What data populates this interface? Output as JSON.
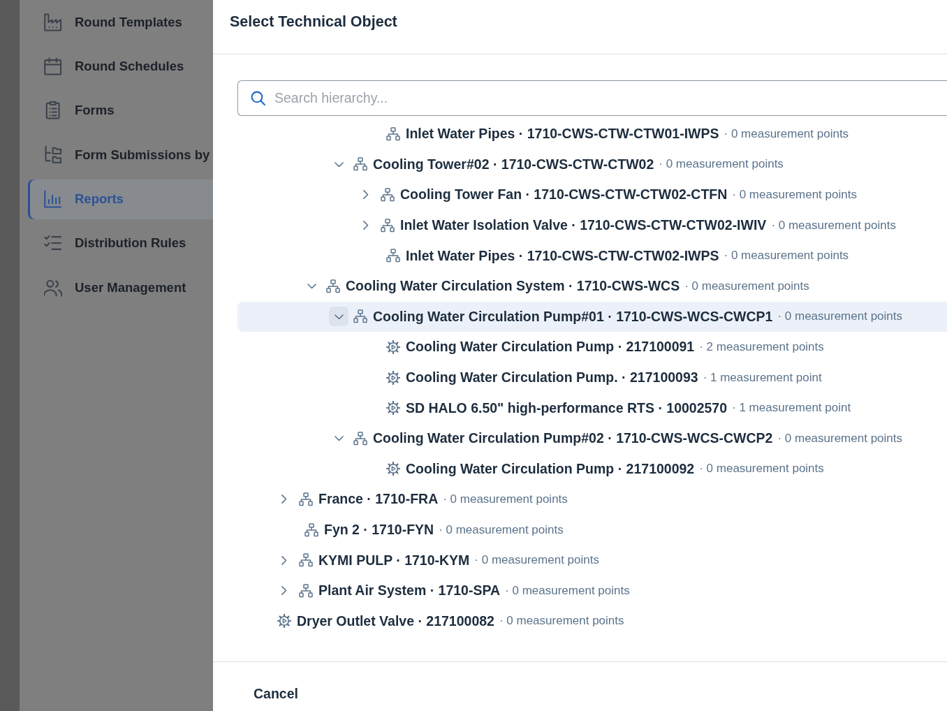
{
  "sidebar": {
    "items": [
      {
        "label": "Round Templates",
        "selected": false
      },
      {
        "label": "Round Schedules",
        "selected": false
      },
      {
        "label": "Forms",
        "selected": false
      },
      {
        "label": "Form Submissions by",
        "selected": false
      },
      {
        "label": "Reports",
        "selected": true
      },
      {
        "label": "Distribution Rules",
        "selected": false
      },
      {
        "label": "User Management",
        "selected": false
      }
    ]
  },
  "dialog": {
    "title": "Select Technical Object",
    "search": {
      "placeholder": "Search hierarchy..."
    },
    "tree": [
      {
        "children": [
          {
            "children": [
              {
                "children": [
                  {
                    "children": [
                      {
                        "kind": "location",
                        "title": "Inlet Water Pipes · 1710-CWS-CTW-CTW01-IWPS",
                        "meta": "· 0 measurement points",
                        "selected": false
                      }
                    ]
                  },
                  {
                    "kind": "location",
                    "title": "Cooling Tower#02 · 1710-CWS-CTW-CTW02",
                    "meta": "· 0 measurement points",
                    "selected": false,
                    "expanded": true,
                    "children": [
                      {
                        "kind": "location",
                        "title": "Cooling Tower Fan · 1710-CWS-CTW-CTW02-CTFN",
                        "meta": "· 0 measurement points",
                        "selected": false,
                        "expanded": false
                      },
                      {
                        "kind": "location",
                        "title": "Inlet Water Isolation Valve · 1710-CWS-CTW-CTW02-IWIV",
                        "meta": "· 0 measurement points",
                        "selected": false,
                        "expanded": false
                      },
                      {
                        "kind": "location",
                        "title": "Inlet Water Pipes · 1710-CWS-CTW-CTW02-IWPS",
                        "meta": "· 0 measurement points",
                        "selected": false
                      }
                    ]
                  }
                ]
              },
              {
                "kind": "location",
                "title": "Cooling Water Circulation System · 1710-CWS-WCS",
                "meta": "· 0 measurement points",
                "selected": false,
                "expanded": true,
                "children": [
                  {
                    "kind": "location",
                    "title": "Cooling Water Circulation Pump#01 · 1710-CWS-WCS-CWCP1",
                    "meta": "· 0 measurement points",
                    "selected": true,
                    "expanded": true,
                    "children": [
                      {
                        "kind": "equipment",
                        "title": "Cooling Water Circulation Pump · 217100091",
                        "meta": "· 2 measurement points",
                        "selected": false
                      },
                      {
                        "kind": "equipment",
                        "title": "Cooling Water Circulation Pump. · 217100093",
                        "meta": "· 1 measurement point",
                        "selected": false
                      },
                      {
                        "kind": "equipment",
                        "title": "SD HALO 6.50\" high-performance RTS · 10002570",
                        "meta": "· 1 measurement point",
                        "selected": false
                      }
                    ]
                  },
                  {
                    "kind": "location",
                    "title": "Cooling Water Circulation Pump#02 · 1710-CWS-WCS-CWCP2",
                    "meta": "· 0 measurement points",
                    "selected": false,
                    "expanded": true,
                    "children": [
                      {
                        "kind": "equipment",
                        "title": "Cooling Water Circulation Pump · 217100092",
                        "meta": "· 0 measurement points",
                        "selected": false
                      }
                    ]
                  }
                ]
              }
            ]
          },
          {
            "kind": "location",
            "title": "France · 1710-FRA",
            "meta": "· 0 measurement points",
            "selected": false,
            "expanded": false
          },
          {
            "kind": "location",
            "title": "Fyn 2 · 1710-FYN",
            "meta": "· 0 measurement points",
            "selected": false
          },
          {
            "kind": "location",
            "title": "KYMI PULP · 1710-KYM",
            "meta": "· 0 measurement points",
            "selected": false,
            "expanded": false
          },
          {
            "kind": "location",
            "title": "Plant Air System · 1710-SPA",
            "meta": "· 0 measurement points",
            "selected": false,
            "expanded": false
          }
        ]
      },
      {
        "kind": "equipment",
        "title": "Dryer Outlet Valve · 217100082",
        "meta": "· 0 measurement points",
        "selected": false
      }
    ],
    "footer": {
      "cancel": "Cancel"
    }
  }
}
